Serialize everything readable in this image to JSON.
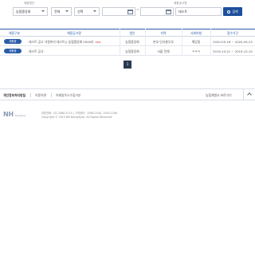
{
  "search": {
    "field1_label": "채용법인",
    "field1_value": "농협중앙회",
    "field2_value": "전체",
    "field3_value": "선택",
    "field4_label": "채용공고명",
    "keyword_value": "테스트",
    "search_button": "검색",
    "tilde": "~"
  },
  "table": {
    "headers": [
      "채용구분",
      "채용공고명",
      "법인",
      "지역",
      "사회보험",
      "접수기간"
    ],
    "rows": [
      {
        "badge": "채용중",
        "title": "테스트 공고   가원마가 테스트() 농협중앙회 0000부",
        "new": "NEW",
        "corp": "농협중앙회",
        "region": "본부 인사총무부",
        "insurance": "해당됨",
        "period": "2020-05-18 ~ 2020-05-23"
      },
      {
        "badge": "채용중",
        "title": "테스트 공고",
        "new": "",
        "corp": "농협중앙회",
        "region": "서울 전체",
        "insurance": "ㅋㅋㅋ",
        "period": "2019-10-21 ~ 2019-12-10"
      }
    ]
  },
  "pagination": {
    "current": "1"
  },
  "footer": {
    "links": [
      "개인정보처리방침",
      "이용약관",
      "이메일주소수집거부"
    ],
    "site_link": "농협계열사 바로가기",
    "logo": "NH",
    "logo_sub": "NongHyup",
    "line1": "대표전화 : 02-2080-5114  |  고객센터 : 1588-2100, 1544-2100",
    "line2": "Copyright © 2015 NH NongHyup. All Rights Reserved."
  },
  "colors": {
    "primary": "#1d4f9c",
    "header_text": "#2a5ca8",
    "pager": "#2b3a52",
    "new": "#e0322e"
  }
}
